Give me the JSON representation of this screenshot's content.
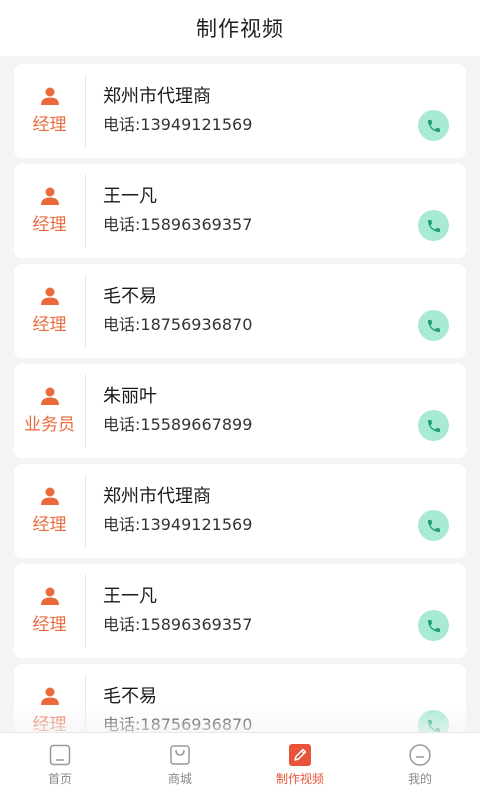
{
  "header": {
    "title": "制作视频"
  },
  "contacts": [
    {
      "role": "经理",
      "name": "郑州市代理商",
      "phone": "电话:13949121569"
    },
    {
      "role": "经理",
      "name": "王一凡",
      "phone": "电话:15896369357"
    },
    {
      "role": "经理",
      "name": "毛不易",
      "phone": "电话:18756936870"
    },
    {
      "role": "业务员",
      "name": "朱丽叶",
      "phone": "电话:15589667899"
    },
    {
      "role": "经理",
      "name": "郑州市代理商",
      "phone": "电话:13949121569"
    },
    {
      "role": "经理",
      "name": "王一凡",
      "phone": "电话:15896369357"
    },
    {
      "role": "经理",
      "name": "毛不易",
      "phone": "电话:18756936870"
    }
  ],
  "tabbar": {
    "items": [
      {
        "label": "首页",
        "icon": "home-icon"
      },
      {
        "label": "商城",
        "icon": "shopping-bag-icon"
      },
      {
        "label": "制作视频",
        "icon": "edit-icon",
        "active": true
      },
      {
        "label": "我的",
        "icon": "profile-icon"
      }
    ]
  },
  "colors": {
    "accent": "#e8533a",
    "role": "#ea6a3e",
    "call_bg": "#a8ead5",
    "call_icon": "#1f9e74"
  }
}
